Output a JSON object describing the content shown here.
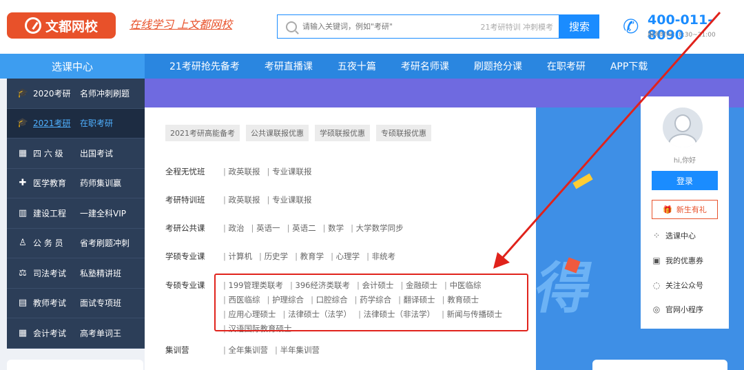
{
  "header": {
    "logo_text": "文都网校",
    "slogan": "在线学习 上文都网校",
    "search_placeholder": "请输入关键词，例如\"考研\"",
    "hot_words": "21考研特训  冲刺模考",
    "search_button": "搜索",
    "phone": "400-011-8090",
    "hours": "服务时间：8:30~21:00"
  },
  "nav": {
    "side_title": "选课中心",
    "items": [
      "21考研抢先备考",
      "考研直播课",
      "五夜十篇",
      "考研名师课",
      "刷题抢分课",
      "在职考研",
      "APP下载"
    ]
  },
  "sidebar": [
    {
      "a": "2020考研",
      "b": "名师冲刺刷题",
      "icon": "graduation-cap-icon"
    },
    {
      "a": "2021考研",
      "b": "在职考研",
      "icon": "graduation-cap-icon"
    },
    {
      "a": "四 六 级",
      "b": "出国考试",
      "icon": "grid-letters-icon"
    },
    {
      "a": "医学教育",
      "b": "药师集训赢",
      "icon": "medical-kit-icon"
    },
    {
      "a": "建设工程",
      "b": "一建全科VIP",
      "icon": "building-icon"
    },
    {
      "a": "公 务 员",
      "b": "省考刷题冲刺",
      "icon": "person-icon"
    },
    {
      "a": "司法考试",
      "b": "私塾精讲班",
      "icon": "gavel-icon"
    },
    {
      "a": "教师考试",
      "b": "面试专项班",
      "icon": "book-icon"
    },
    {
      "a": "会计考试",
      "b": "高考单词王",
      "icon": "calculator-icon"
    }
  ],
  "panel": {
    "tags": [
      "2021考研高能备考",
      "公共课联报优惠",
      "学硕联报优惠",
      "专硕联报优惠"
    ],
    "rows": [
      {
        "label": "全程无忧班",
        "items": [
          "政英联报",
          "专业课联报"
        ]
      },
      {
        "label": "考研特训班",
        "items": [
          "政英联报",
          "专业课联报"
        ]
      },
      {
        "label": "考研公共课",
        "items": [
          "政治",
          "英语一",
          "英语二",
          "数学",
          "大学数学同步"
        ]
      },
      {
        "label": "学硕专业课",
        "items": [
          "计算机",
          "历史学",
          "教育学",
          "心理学",
          "非统考"
        ]
      },
      {
        "label": "专硕专业课",
        "items": [
          "199管理类联考",
          "396经济类联考",
          "会计硕士",
          "金融硕士",
          "中医临综",
          "西医临综",
          "护理综合",
          "口腔综合",
          "药学综合",
          "翻译硕士",
          "教育硕士",
          "应用心理硕士",
          "法律硕士（法学）",
          "法律硕士（非法学）",
          "新闻与传播硕士",
          "汉语国际教育硕士"
        ]
      },
      {
        "label": "集训营",
        "items": [
          "全年集训营",
          "半年集训营"
        ]
      }
    ]
  },
  "login": {
    "greeting": "hi,你好",
    "login_button": "登录",
    "gift": "新生有礼",
    "links": [
      {
        "label": "选课中心",
        "icon": "grid-icon"
      },
      {
        "label": "我的优惠券",
        "icon": "coupon-icon"
      },
      {
        "label": "关注公众号",
        "icon": "wechat-icon"
      },
      {
        "label": "官网小程序",
        "icon": "mini-program-icon"
      }
    ]
  },
  "banner_text": "得",
  "colors": {
    "brand": "#e8512a",
    "primary": "#1a8cff",
    "highlight": "#e0221b"
  }
}
